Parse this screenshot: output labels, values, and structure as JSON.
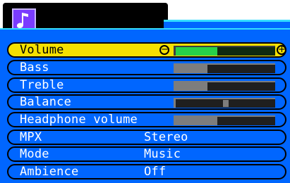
{
  "menu": {
    "icon": "music-note-icon",
    "rows": [
      {
        "label": "Volume",
        "type": "slider",
        "level": 0.42,
        "selected": true
      },
      {
        "label": "Bass",
        "type": "slider",
        "level": 0.32,
        "selected": false
      },
      {
        "label": "Treble",
        "type": "slider",
        "level": 0.32,
        "selected": false
      },
      {
        "label": "Balance",
        "type": "balance",
        "level": 0.5,
        "selected": false
      },
      {
        "label": "Headphone volume",
        "type": "slider",
        "level": 0.42,
        "selected": false
      },
      {
        "label": "MPX",
        "type": "value",
        "value": "Stereo",
        "selected": false
      },
      {
        "label": "Mode",
        "type": "value",
        "value": "Music",
        "selected": false
      },
      {
        "label": "Ambience",
        "type": "value",
        "value": "Off",
        "selected": false
      }
    ]
  },
  "colors": {
    "menu_background": "#0066ff",
    "selected_row": "#f5e000",
    "volume_fill": "#27d14a",
    "slider_fill": "#7d7d7d",
    "track": "#1f1f1f",
    "icon_background": "#7a3cff"
  }
}
